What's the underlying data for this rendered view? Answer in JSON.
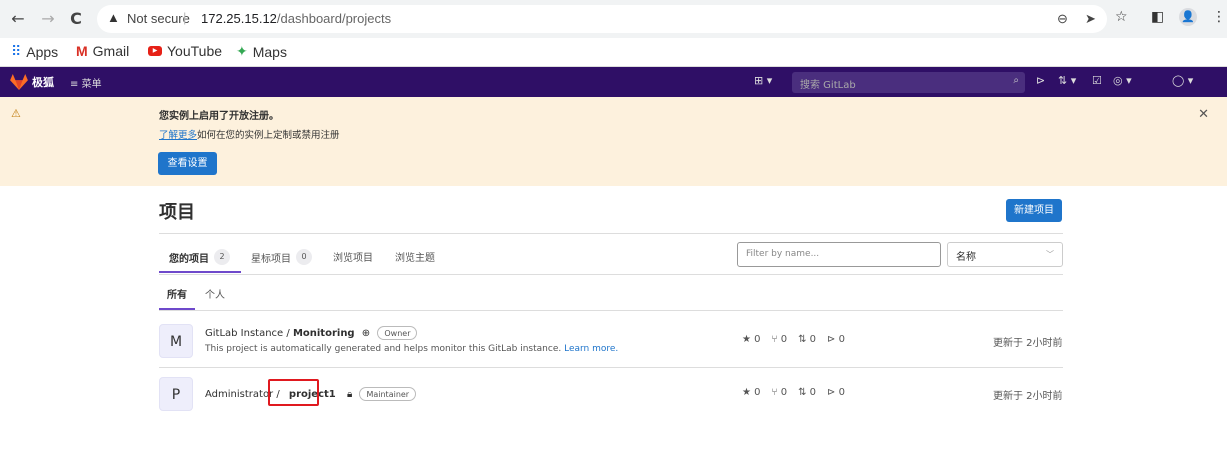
{
  "browser": {
    "security_label": "Not secure",
    "url_host": "172.25.15.12",
    "url_path": "/dashboard/projects",
    "bookmarks": [
      {
        "label": "Apps",
        "icon": "apps-grid-icon"
      },
      {
        "label": "Gmail",
        "icon": "gmail-icon"
      },
      {
        "label": "YouTube",
        "icon": "youtube-icon"
      },
      {
        "label": "Maps",
        "icon": "maps-icon"
      }
    ]
  },
  "gitlab_nav": {
    "brand": "极狐",
    "menu_label": "菜单",
    "search_placeholder": "搜索 GitLab"
  },
  "banner": {
    "title": "您实例上启用了开放注册。",
    "learn_more": "了解更多",
    "line2_rest": "如何在您的实例上定制或禁用注册",
    "button": "查看设置"
  },
  "page": {
    "title": "项目",
    "new_button": "新建项目",
    "tabs": [
      {
        "label": "您的项目",
        "count": "2"
      },
      {
        "label": "星标项目",
        "count": "0"
      },
      {
        "label": "浏览项目"
      },
      {
        "label": "浏览主题"
      }
    ],
    "filter_placeholder": "Filter by name...",
    "sort_value": "名称",
    "subtabs": [
      "所有",
      "个人"
    ]
  },
  "projects": [
    {
      "avatar": "M",
      "namespace": "GitLab Instance / ",
      "name": "Monitoring",
      "role": "Owner",
      "description": "This project is automatically generated and helps monitor this GitLab instance.",
      "description_link": "Learn more.",
      "stars": "0",
      "forks": "0",
      "mrs": "0",
      "issues": "0",
      "updated": "更新于 2小时前"
    },
    {
      "avatar": "P",
      "namespace": "Administrator / ",
      "name": "project1",
      "role": "Maintainer",
      "stars": "0",
      "forks": "0",
      "mrs": "0",
      "issues": "0",
      "updated": "更新于 2小时前"
    }
  ],
  "colors": {
    "gitlab_nav_bg": "#2f0f66",
    "banner_bg": "#fdf1dd",
    "primary_button": "#1f75cb",
    "active_tab_underline": "#6e49cb",
    "highlight_box": "#e0191f"
  }
}
